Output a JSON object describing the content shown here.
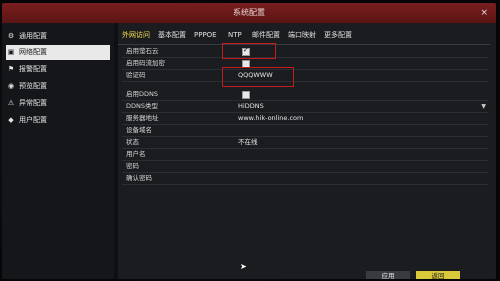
{
  "window": {
    "title": "系统配置",
    "close": "×"
  },
  "sidebar": {
    "items": [
      {
        "label": "通用配置",
        "icon": "gear-icon",
        "glyph": "⚙"
      },
      {
        "label": "网络配置",
        "icon": "network-icon",
        "glyph": "▣",
        "active": true
      },
      {
        "label": "报警配置",
        "icon": "alarm-icon",
        "glyph": "⚑"
      },
      {
        "label": "预览配置",
        "icon": "preview-icon",
        "glyph": "◉"
      },
      {
        "label": "异常配置",
        "icon": "warning-icon",
        "glyph": "⚠"
      },
      {
        "label": "用户配置",
        "icon": "user-icon",
        "glyph": "◆"
      }
    ]
  },
  "tabs": [
    {
      "label": "外网访问",
      "active": true
    },
    {
      "label": "基本配置"
    },
    {
      "label": "PPPOE"
    },
    {
      "label": "NTP"
    },
    {
      "label": "邮件配置"
    },
    {
      "label": "端口映射"
    },
    {
      "label": "更多配置"
    }
  ],
  "form": {
    "ezviz_enable": {
      "label": "启用萤石云",
      "checked": true
    },
    "stream_encrypt": {
      "label": "启用码流加密",
      "checked": false
    },
    "verify_code": {
      "label": "验证码",
      "value": "QQQWWW"
    },
    "ddns_enable": {
      "label": "启用DDNS",
      "checked": false
    },
    "ddns_type": {
      "label": "DDNS类型",
      "value": "HiDDNS"
    },
    "server_address": {
      "label": "服务器地址",
      "value": "www.hik-online.com"
    },
    "device_domain": {
      "label": "设备域名",
      "value": ""
    },
    "status": {
      "label": "状态",
      "value": "不在线"
    },
    "username": {
      "label": "用户名",
      "value": ""
    },
    "password": {
      "label": "密码",
      "value": ""
    },
    "confirm_password": {
      "label": "确认密码",
      "value": ""
    }
  },
  "buttons": {
    "apply": "应用",
    "back": "返回"
  }
}
